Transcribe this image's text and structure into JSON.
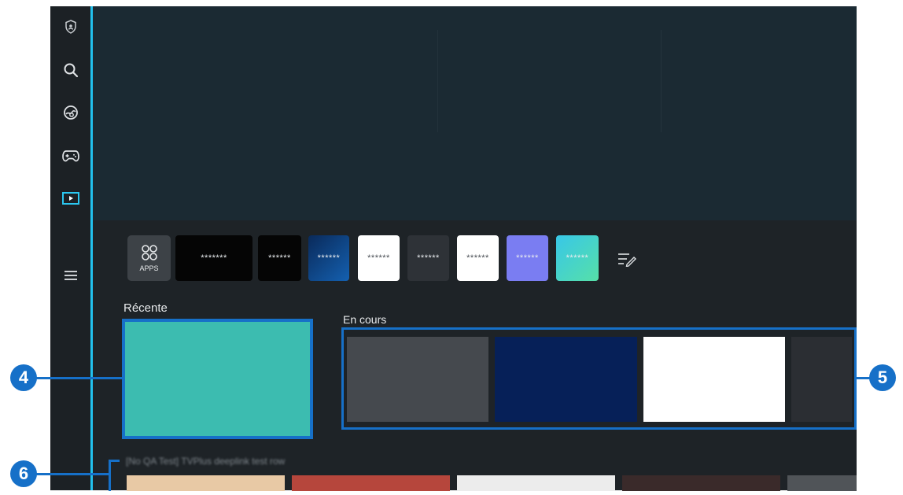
{
  "apps_row": {
    "apps_button_label": "APPS",
    "tiles": [
      {
        "label": "*******",
        "bg": "#050505"
      },
      {
        "label": "******",
        "bg": "#050505"
      },
      {
        "label": "******",
        "bg": "#0d3d7a"
      },
      {
        "label": "******",
        "bg": "#ffffff"
      },
      {
        "label": "******",
        "bg": "#2e3237"
      },
      {
        "label": "******",
        "bg": "#ffffff"
      },
      {
        "label": "******",
        "bg": "#7a7df2"
      },
      {
        "label": "******",
        "bg": "#3fd7d3"
      }
    ]
  },
  "sections": {
    "recent_label": "Récente",
    "in_progress_label": "En cours"
  },
  "in_progress_items": [
    {
      "color": "#45494e"
    },
    {
      "color": "#062058"
    },
    {
      "color": "#ffffff"
    },
    {
      "color": "#2b2e33"
    }
  ],
  "row_title": "[No QA Test] TVPlus deeplink test row",
  "bottom_row_colors": [
    "#e8c9a5",
    "#b6463c",
    "#ececec",
    "#3a2a2a",
    "#505458"
  ],
  "callouts": {
    "four": "4",
    "five": "5",
    "six": "6"
  },
  "colors": {
    "accent": "#1670c8",
    "focus_line": "#22c1ee",
    "screen_bg": "#1e2327"
  },
  "rail_icons": [
    "privacy-icon",
    "search-icon",
    "ambient-icon",
    "game-controller-icon",
    "media-icon",
    "menu-icon"
  ]
}
